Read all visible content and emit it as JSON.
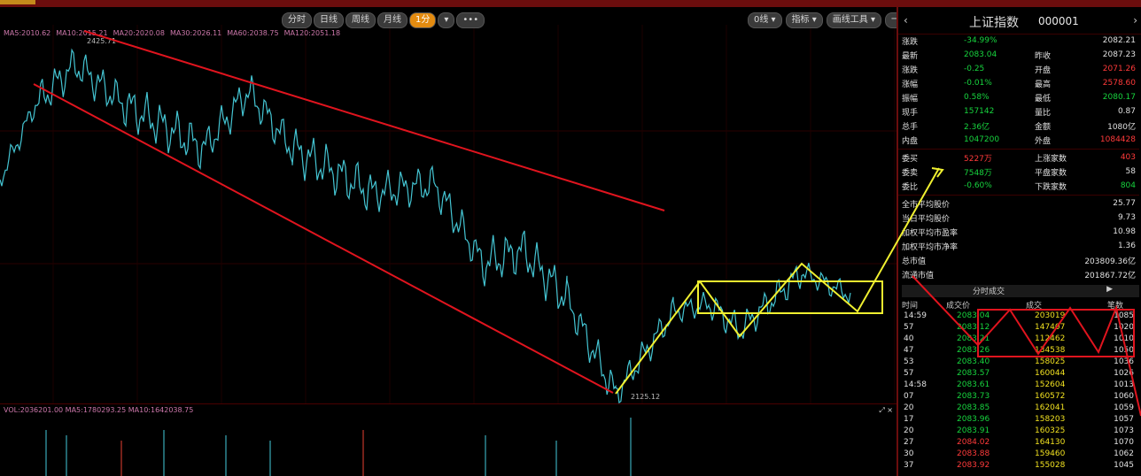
{
  "colors": {
    "background": "#000000",
    "frame": "#6b0d0d",
    "price_line": "#44c4d2",
    "trend_red": "#e0141e",
    "pattern_yellow": "#f0f030",
    "up": "#ff3a3a",
    "down": "#17d43e"
  },
  "toolbar": {
    "buttons": [
      "分时",
      "日线",
      "周线",
      "月线",
      "1分"
    ],
    "active_index": 4,
    "dropdown_icon": "caret-down-icon",
    "more_icon": "ellipsis-icon",
    "right_buttons": [
      "0线",
      "指标",
      "画线工具",
      "一指标"
    ],
    "tool_icons": [
      "settings-icon",
      "close-icon"
    ]
  },
  "legend": [
    "MA5:2010.62",
    "MA10:2015.21",
    "MA20:2020.08",
    "MA30:2026.11",
    "MA60:2038.75",
    "MA120:2051.18"
  ],
  "price_labels": {
    "high": "2425.71",
    "low": "2125.12"
  },
  "volume_legend": "VOL:2036201.00 MA5:1780293.25 MA10:1642038.75",
  "chart_data": {
    "type": "line",
    "y_extremes": {
      "high": 2425.71,
      "low": 2125.12
    }
  },
  "panel": {
    "name": "上证指数",
    "code": "000001",
    "left_nav": "‹",
    "right_nav": "›",
    "quotes": [
      {
        "l1": "涨跌",
        "v1": "-34.99%",
        "c1": "green",
        "l2": "",
        "v2": "2082.21",
        "c2": "white"
      },
      {
        "l1": "最新",
        "v1": "2083.04",
        "c1": "green",
        "l2": "昨收",
        "v2": "2087.23",
        "c2": "white"
      },
      {
        "l1": "涨跌",
        "v1": "-0.25",
        "c1": "green",
        "l2": "开盘",
        "v2": "2071.26",
        "c2": "red"
      },
      {
        "l1": "涨幅",
        "v1": "-0.01%",
        "c1": "green",
        "l2": "最高",
        "v2": "2578.60",
        "c2": "red"
      },
      {
        "l1": "振幅",
        "v1": "0.58%",
        "c1": "green",
        "l2": "最低",
        "v2": "2080.17",
        "c2": "green"
      },
      {
        "l1": "现手",
        "v1": "157142",
        "c1": "green",
        "l2": "量比",
        "v2": "0.87",
        "c2": "white"
      },
      {
        "l1": "总手",
        "v1": "2.36亿",
        "c1": "green",
        "l2": "金额",
        "v2": "1080亿",
        "c2": "white"
      },
      {
        "l1": "内盘",
        "v1": "1047200",
        "c1": "green",
        "l2": "外盘",
        "v2": "1084428",
        "c2": "red"
      }
    ],
    "breadth": [
      {
        "l1": "委买",
        "v1": "5227万",
        "c1": "red",
        "l2": "上涨家数",
        "v2": "403",
        "c2": "red"
      },
      {
        "l1": "委卖",
        "v1": "7548万",
        "c1": "green",
        "l2": "平盘家数",
        "v2": "58",
        "c2": "white"
      },
      {
        "l1": "委比",
        "v1": "-0.60%",
        "c1": "green",
        "l2": "下跌家数",
        "v2": "804",
        "c2": "green"
      }
    ],
    "stats": [
      {
        "label": "全市平均股价",
        "value": "25.77"
      },
      {
        "label": "当日平均股价",
        "value": "9.73"
      },
      {
        "label": "加权平均市盈率",
        "value": "10.98"
      },
      {
        "label": "加权平均市净率",
        "value": "1.36"
      },
      {
        "label": "总市值",
        "value": "203809.36亿"
      },
      {
        "label": "流通市值",
        "value": "201867.72亿"
      }
    ],
    "ticks_title": "分时成交",
    "ticks_headers": [
      "时间",
      "成交价",
      "成交",
      "笔数"
    ],
    "ticks": [
      {
        "t": "14:59",
        "p": "2083.04",
        "pc": "green",
        "v": "203019",
        "n": "1085"
      },
      {
        "t": "57",
        "p": "2083.12",
        "pc": "green",
        "v": "147407",
        "n": "1020"
      },
      {
        "t": "40",
        "p": "2083.21",
        "pc": "green",
        "v": "112462",
        "n": "1010"
      },
      {
        "t": "47",
        "p": "2083.26",
        "pc": "green",
        "v": "134538",
        "n": "1050"
      },
      {
        "t": "53",
        "p": "2083.40",
        "pc": "green",
        "v": "158025",
        "n": "1036"
      },
      {
        "t": "57",
        "p": "2083.57",
        "pc": "green",
        "v": "160044",
        "n": "1026"
      },
      {
        "t": "14:58",
        "p": "2083.61",
        "pc": "green",
        "v": "152604",
        "n": "1013"
      },
      {
        "t": "07",
        "p": "2083.73",
        "pc": "green",
        "v": "160572",
        "n": "1060"
      },
      {
        "t": "20",
        "p": "2083.85",
        "pc": "green",
        "v": "162041",
        "n": "1059"
      },
      {
        "t": "17",
        "p": "2083.96",
        "pc": "green",
        "v": "158203",
        "n": "1057"
      },
      {
        "t": "20",
        "p": "2083.91",
        "pc": "green",
        "v": "160325",
        "n": "1073"
      },
      {
        "t": "27",
        "p": "2084.02",
        "pc": "red",
        "v": "164130",
        "n": "1070"
      },
      {
        "t": "30",
        "p": "2083.88",
        "pc": "red",
        "v": "159460",
        "n": "1062"
      },
      {
        "t": "37",
        "p": "2083.92",
        "pc": "red",
        "v": "155028",
        "n": "1045"
      }
    ]
  }
}
